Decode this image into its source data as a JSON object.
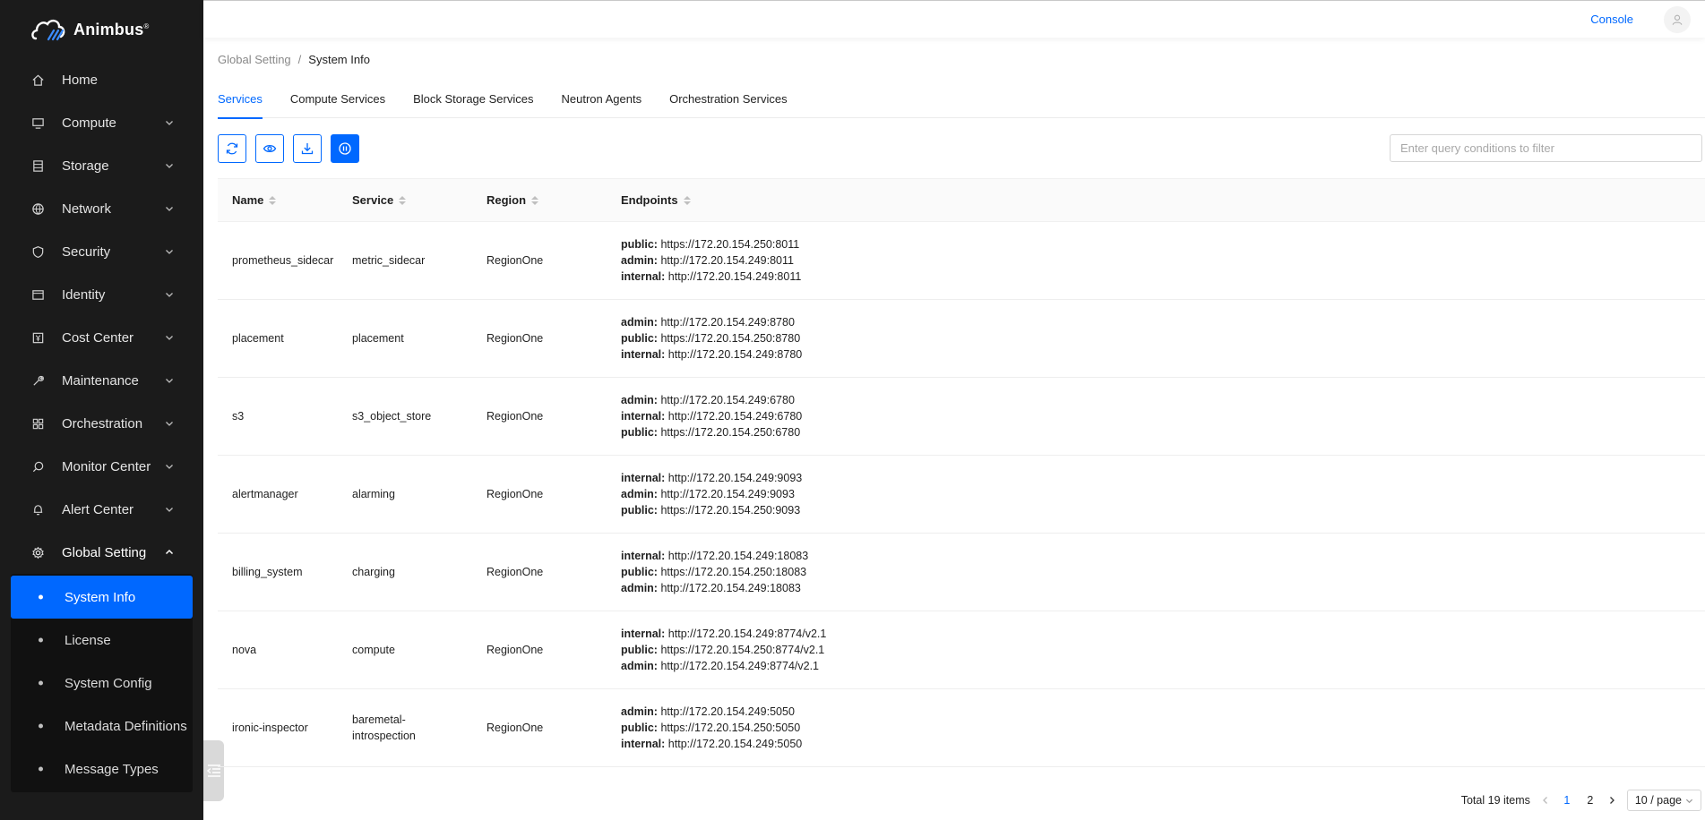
{
  "app": {
    "brand": "Animbus",
    "brand_mark": "®"
  },
  "header": {
    "console_label": "Console"
  },
  "sidebar": {
    "items": [
      {
        "label": "Home",
        "icon": "home-icon"
      },
      {
        "label": "Compute",
        "icon": "monitor-icon"
      },
      {
        "label": "Storage",
        "icon": "storage-icon"
      },
      {
        "label": "Network",
        "icon": "globe-icon"
      },
      {
        "label": "Security",
        "icon": "shield-icon"
      },
      {
        "label": "Identity",
        "icon": "id-card-icon"
      },
      {
        "label": "Cost Center",
        "icon": "yen-icon"
      },
      {
        "label": "Maintenance",
        "icon": "wrench-icon"
      },
      {
        "label": "Orchestration",
        "icon": "grid-icon"
      },
      {
        "label": "Monitor Center",
        "icon": "search-icon"
      },
      {
        "label": "Alert Center",
        "icon": "bell-icon"
      },
      {
        "label": "Global Setting",
        "icon": "gear-icon"
      }
    ],
    "submenu": [
      {
        "label": "System Info",
        "selected": true
      },
      {
        "label": "License"
      },
      {
        "label": "System Config"
      },
      {
        "label": "Metadata Definitions"
      },
      {
        "label": "Message Types"
      }
    ]
  },
  "breadcrumb": {
    "parent": "Global Setting",
    "separator": "/",
    "current": "System Info"
  },
  "tabs": [
    {
      "label": "Services",
      "active": true
    },
    {
      "label": "Compute Services"
    },
    {
      "label": "Block Storage Services"
    },
    {
      "label": "Neutron Agents"
    },
    {
      "label": "Orchestration Services"
    }
  ],
  "toolbar": {
    "buttons": [
      "refresh-icon",
      "eye-icon",
      "download-icon",
      "pause-icon"
    ],
    "filter_placeholder": "Enter query conditions to filter"
  },
  "table": {
    "columns": [
      "Name",
      "Service",
      "Region",
      "Endpoints"
    ],
    "rows": [
      {
        "name": "prometheus_sidecar",
        "service": "metric_sidecar",
        "region": "RegionOne",
        "endpoints": [
          {
            "k": "public:",
            "v": "https://172.20.154.250:8011"
          },
          {
            "k": "admin:",
            "v": "http://172.20.154.249:8011"
          },
          {
            "k": "internal:",
            "v": "http://172.20.154.249:8011"
          }
        ]
      },
      {
        "name": "placement",
        "service": "placement",
        "region": "RegionOne",
        "endpoints": [
          {
            "k": "admin:",
            "v": "http://172.20.154.249:8780"
          },
          {
            "k": "public:",
            "v": "https://172.20.154.250:8780"
          },
          {
            "k": "internal:",
            "v": "http://172.20.154.249:8780"
          }
        ]
      },
      {
        "name": "s3",
        "service": "s3_object_store",
        "region": "RegionOne",
        "endpoints": [
          {
            "k": "admin:",
            "v": "http://172.20.154.249:6780"
          },
          {
            "k": "internal:",
            "v": "http://172.20.154.249:6780"
          },
          {
            "k": "public:",
            "v": "https://172.20.154.250:6780"
          }
        ]
      },
      {
        "name": "alertmanager",
        "service": "alarming",
        "region": "RegionOne",
        "endpoints": [
          {
            "k": "internal:",
            "v": "http://172.20.154.249:9093"
          },
          {
            "k": "admin:",
            "v": "http://172.20.154.249:9093"
          },
          {
            "k": "public:",
            "v": "https://172.20.154.250:9093"
          }
        ]
      },
      {
        "name": "billing_system",
        "service": "charging",
        "region": "RegionOne",
        "endpoints": [
          {
            "k": "internal:",
            "v": "http://172.20.154.249:18083"
          },
          {
            "k": "public:",
            "v": "https://172.20.154.250:18083"
          },
          {
            "k": "admin:",
            "v": "http://172.20.154.249:18083"
          }
        ]
      },
      {
        "name": "nova",
        "service": "compute",
        "region": "RegionOne",
        "endpoints": [
          {
            "k": "internal:",
            "v": "http://172.20.154.249:8774/v2.1"
          },
          {
            "k": "public:",
            "v": "https://172.20.154.250:8774/v2.1"
          },
          {
            "k": "admin:",
            "v": "http://172.20.154.249:8774/v2.1"
          }
        ]
      },
      {
        "name": "ironic-inspector",
        "service": "baremetal-\nintrospection",
        "region": "RegionOne",
        "endpoints": [
          {
            "k": "admin:",
            "v": "http://172.20.154.249:5050"
          },
          {
            "k": "public:",
            "v": "https://172.20.154.250:5050"
          },
          {
            "k": "internal:",
            "v": "http://172.20.154.249:5050"
          }
        ]
      }
    ]
  },
  "pagination": {
    "total_label": "Total 19 items",
    "pages": [
      "1",
      "2"
    ],
    "current": "1",
    "page_size_label": "10 / page"
  }
}
